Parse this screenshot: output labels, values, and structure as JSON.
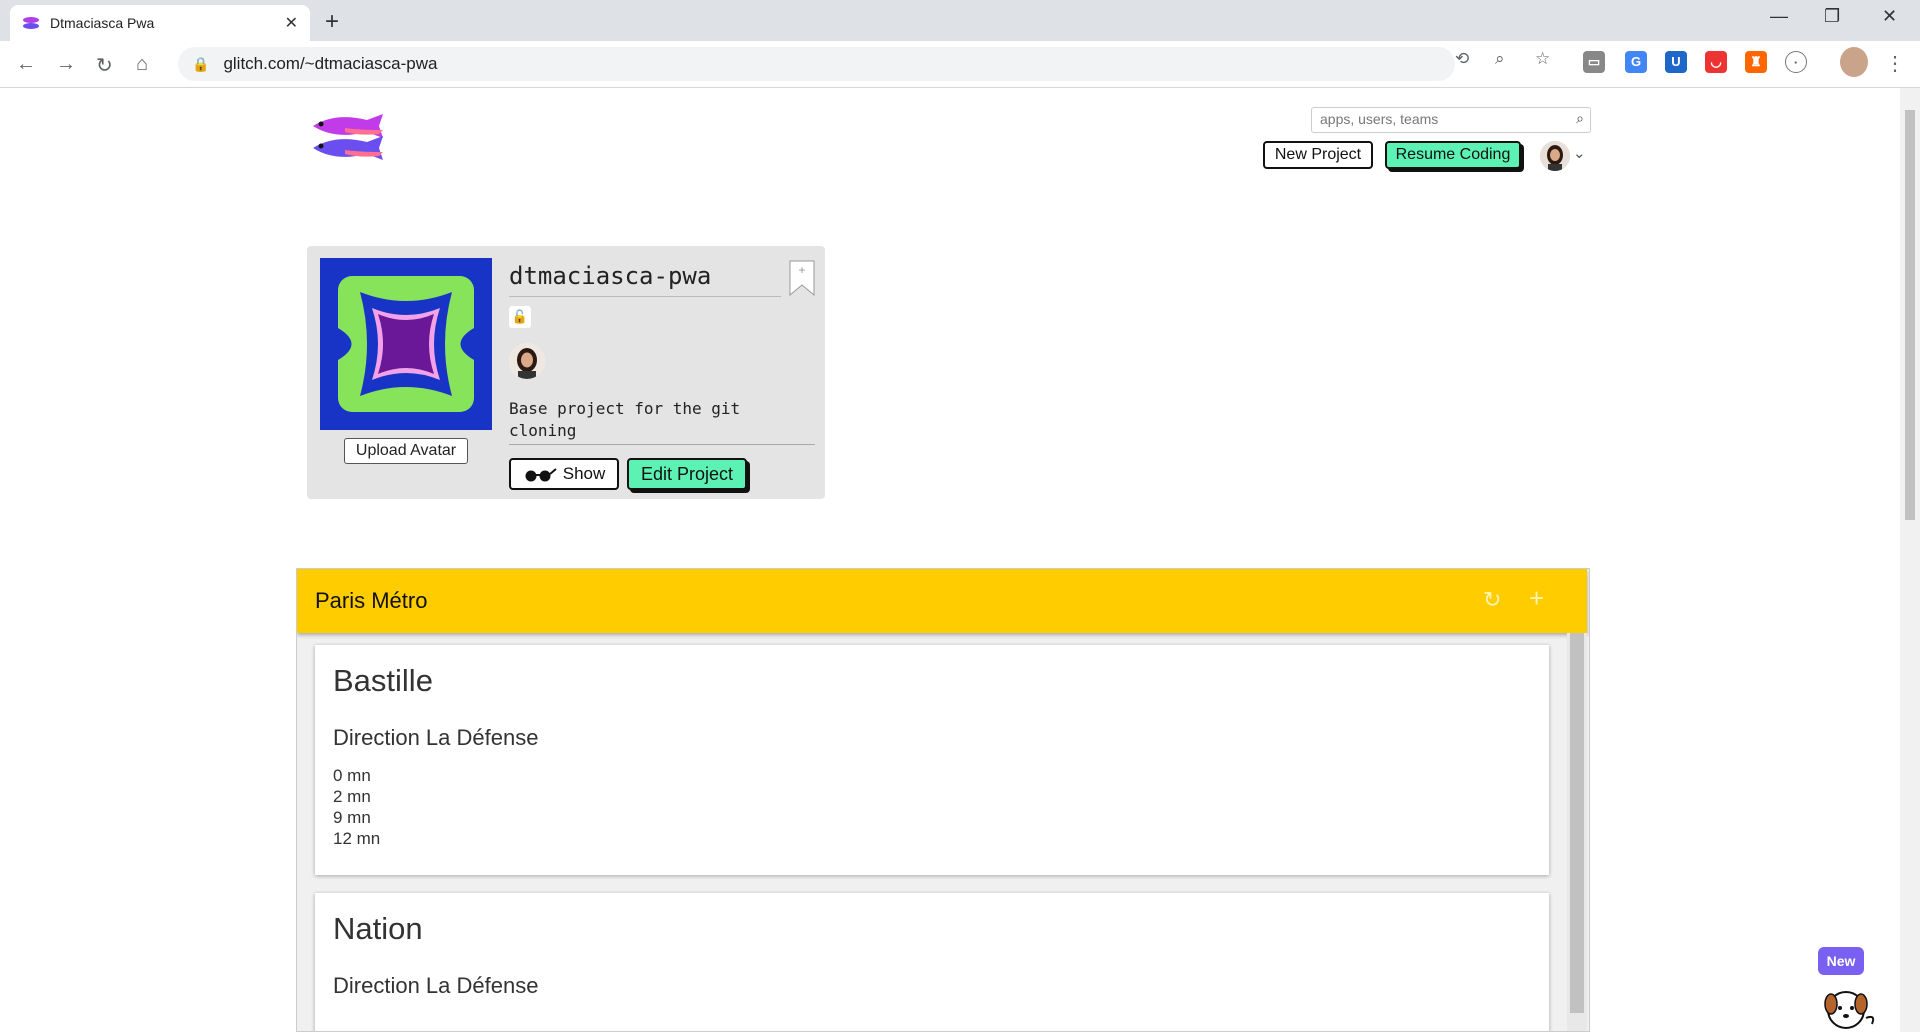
{
  "browser": {
    "tab_title": "Dtmaciasca Pwa",
    "url": "glitch.com/~dtmaciasca-pwa"
  },
  "header": {
    "search_placeholder": "apps, users, teams",
    "new_project": "New Project",
    "resume_coding": "Resume Coding"
  },
  "project": {
    "name": "dtmaciasca-pwa",
    "upload_avatar": "Upload Avatar",
    "description": "Base project for the git cloning",
    "show_label": "Show",
    "edit_label": "Edit Project"
  },
  "embed": {
    "title": "Paris Métro",
    "stations": [
      {
        "name": "Bastille",
        "direction": "Direction La Défense",
        "times": [
          "0 mn",
          "2 mn",
          "9 mn",
          "12 mn"
        ]
      },
      {
        "name": "Nation",
        "direction": "Direction La Défense"
      }
    ]
  },
  "widget": {
    "badge": "New"
  },
  "colors": {
    "accent_green": "#5cf2b4",
    "header_yellow": "#ffcc00",
    "avatar_blue": "#1834c7"
  }
}
